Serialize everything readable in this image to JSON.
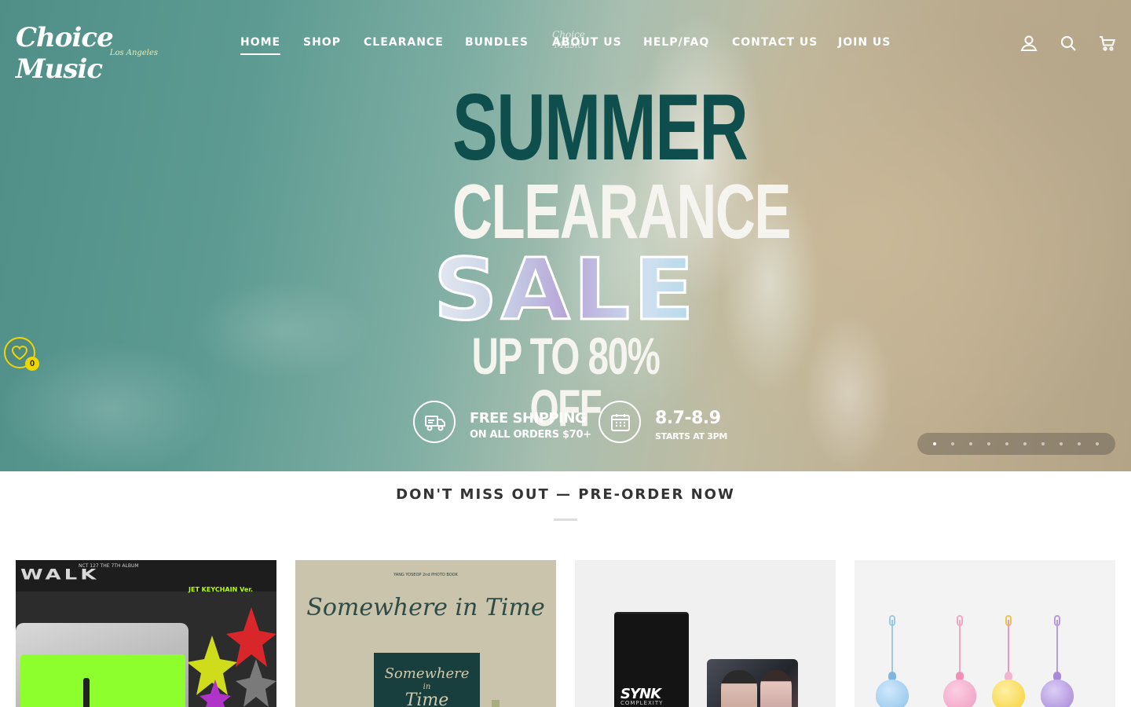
{
  "header": {
    "logo_text": "Choice Music",
    "logo_sub": "Los Angeles",
    "nav": [
      {
        "label": "HOME",
        "active": true
      },
      {
        "label": "SHOP",
        "active": false
      },
      {
        "label": "CLEARANCE",
        "active": false
      },
      {
        "label": "BUNDLES",
        "active": false
      },
      {
        "label": "ABOUT US",
        "active": false
      },
      {
        "label": "HELP/FAQ",
        "active": false
      },
      {
        "label": "CONTACT US",
        "active": false
      },
      {
        "label": "JOIN US",
        "active": false
      }
    ],
    "icons": [
      "account-icon",
      "search-icon",
      "cart-icon"
    ]
  },
  "hero": {
    "line1": "SUMMER",
    "line2": "CLEARANCE",
    "line3": "SALE",
    "line4": "UP TO 80% OFF",
    "badge1_title": "FREE SHIPPING",
    "badge1_sub": "ON ALL ORDERS $70+",
    "badge2_title": "8.7-8.9",
    "badge2_sub": "STARTS AT 3PM",
    "slide_count": 10,
    "active_slide": 1,
    "colors": {
      "summer": "#0e4e4c",
      "clearance": "#f6f4ee"
    }
  },
  "wishlist": {
    "count": "0",
    "accent": "#f0d600"
  },
  "preorder": {
    "title": "DON'T MISS OUT — PRE-ORDER NOW",
    "products": [
      {
        "image_text": "NCT 127 THE 7TH ALBUM",
        "image_title": "WALK",
        "image_version": "JET KEYCHAIN Ver."
      },
      {
        "image_text": "YANG YOSEOP 2nd PHOTO BOOK",
        "image_title": "Somewhere in Time"
      },
      {
        "image_title": "SYNK",
        "image_text": "COMPLEXITY"
      },
      {
        "image_text": ""
      }
    ]
  }
}
